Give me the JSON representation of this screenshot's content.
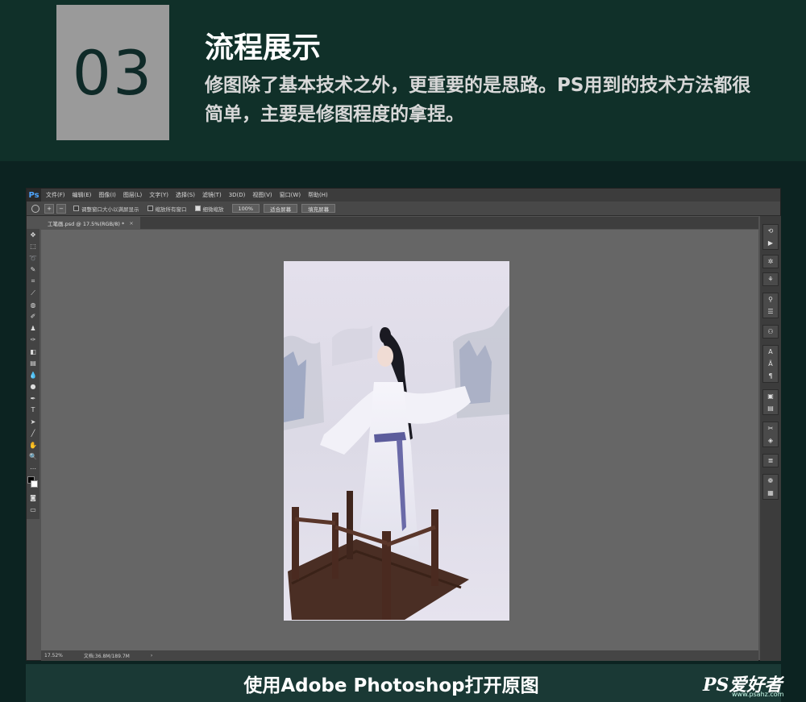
{
  "header": {
    "step_number": "03",
    "title": "流程展示",
    "description": "修图除了基本技术之外，更重要的是思路。PS用到的技术方法都很简单，主要是修图程度的拿捏。"
  },
  "photoshop": {
    "logo": "Ps",
    "menu": [
      "文件(F)",
      "编辑(E)",
      "图像(I)",
      "图层(L)",
      "文字(Y)",
      "选择(S)",
      "滤镜(T)",
      "3D(D)",
      "视图(V)",
      "窗口(W)",
      "帮助(H)"
    ],
    "options": {
      "resize_windows_label": "调整窗口大小以满屏显示",
      "zoom_all_label": "缩放所有窗口",
      "scrubby_zoom_label": "细微缩放",
      "zoom_value": "100%",
      "fit_screen_label": "适合屏幕",
      "fill_screen_label": "填充屏幕"
    },
    "document_tab": {
      "label": "工笔画.psd @ 17.5%(RGB/8) *",
      "close": "×"
    },
    "status": {
      "zoom": "17.52%",
      "doc_size": "文档:36.8M/189.7M",
      "arrow": "›"
    }
  },
  "caption": {
    "text": "使用Adobe Photoshop打开原图"
  },
  "watermark": {
    "main": "PS爱好者",
    "sub": "www.psahz.com"
  },
  "colors": {
    "background": "#0f2a28",
    "step_box": "#9a9a9a",
    "caption_band": "#1a3935"
  }
}
